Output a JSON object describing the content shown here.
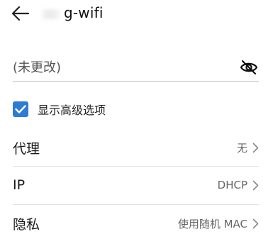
{
  "header": {
    "title": "g-wifi",
    "back_icon": "arrow-left-icon"
  },
  "password": {
    "placeholder": "(未更改)",
    "visibility_icon": "eye-off-icon"
  },
  "advanced": {
    "label": "显示高级选项",
    "checked": true,
    "accent": "#2e7bd6"
  },
  "rows": [
    {
      "label": "代理",
      "value": "无"
    },
    {
      "label": "IP",
      "value": "DHCP"
    },
    {
      "label": "隐私",
      "value": "使用随机 MAC"
    }
  ],
  "colors": {
    "background": "#ffffff",
    "text": "#1a1a1a",
    "secondary_text": "#666666",
    "divider": "#e3e3e3"
  }
}
